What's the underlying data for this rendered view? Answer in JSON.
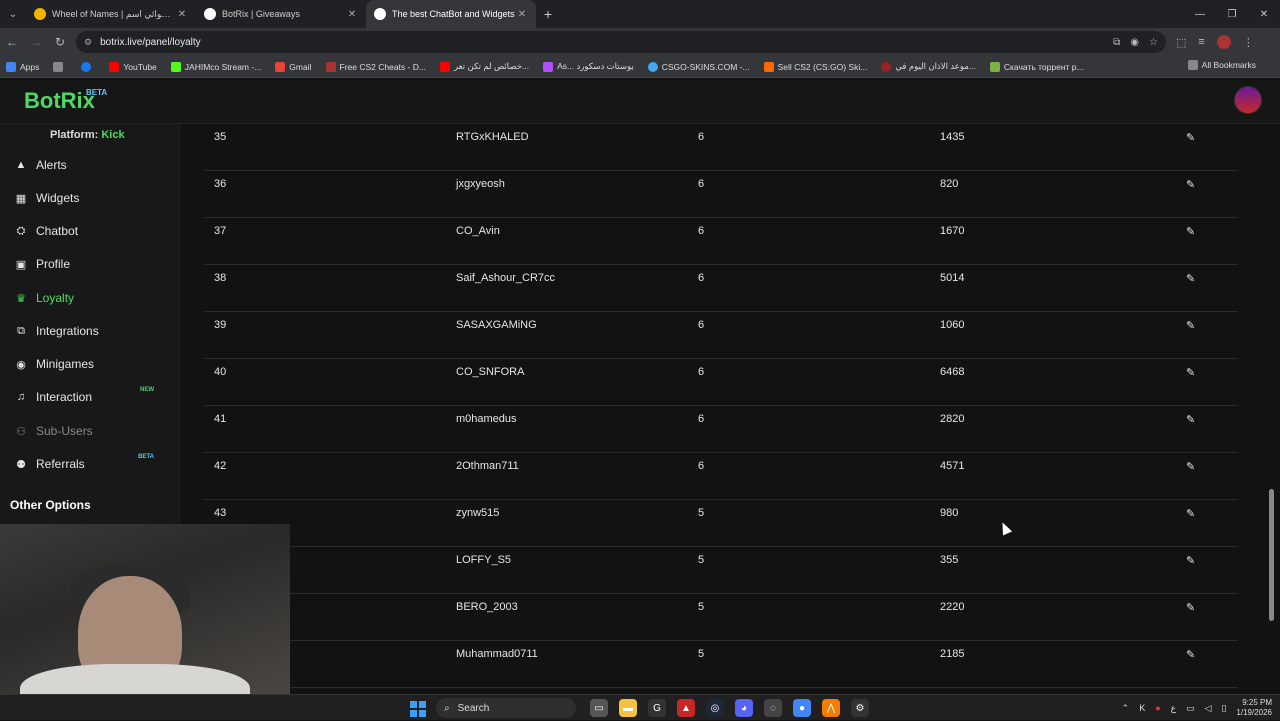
{
  "browser": {
    "tabs": [
      {
        "title": "Wheel of Names | العشوائي اسم",
        "icon": "wheel-icon",
        "color": "#f4b400"
      },
      {
        "title": "BotRix | Giveaways",
        "icon": "botrix-icon",
        "color": "#ffffff"
      },
      {
        "title": "The best ChatBot and Widgets",
        "icon": "botrix-icon",
        "color": "#ffffff"
      }
    ],
    "url": "botrix.live/panel/loyalty",
    "bookmarks": [
      {
        "label": "Apps",
        "color": "#4285f4"
      },
      {
        "label": "",
        "color": "#888888"
      },
      {
        "label": "",
        "color": "#1877f2"
      },
      {
        "label": "YouTube",
        "color": "#ff0000"
      },
      {
        "label": "JAHIMco Stream -...",
        "color": "#53fc18"
      },
      {
        "label": "Gmail",
        "color": "#ea4335"
      },
      {
        "label": "Free CS2 Cheats - D...",
        "color": "#aa3333"
      },
      {
        "label": "خصائص لم تكن تعر...",
        "color": "#ff0000"
      },
      {
        "label": "As... يوستات دسكورد",
        "color": "#b44cff"
      },
      {
        "label": "CSGO-SKINS.COM -...",
        "color": "#3fa9f5"
      },
      {
        "label": "Sell CS2 (CS:GO) Ski...",
        "color": "#ff6a00"
      },
      {
        "label": "موعد الاذان اليوم في...",
        "color": "#992222"
      },
      {
        "label": "Скачать торрент р...",
        "color": "#7cb342"
      }
    ],
    "all_bookmarks": "All Bookmarks"
  },
  "app": {
    "logo": "BotRix",
    "logo_badge": "BETA",
    "platform_label": "Platform:",
    "platform_value": "Kick"
  },
  "sidebar": {
    "items": [
      {
        "label": "Alerts",
        "icon": "alert-triangle-icon"
      },
      {
        "label": "Widgets",
        "icon": "grid-icon"
      },
      {
        "label": "Chatbot",
        "icon": "robot-icon"
      },
      {
        "label": "Profile",
        "icon": "id-card-icon"
      },
      {
        "label": "Loyalty",
        "icon": "trophy-icon",
        "active": true
      },
      {
        "label": "Integrations",
        "icon": "plug-icon"
      },
      {
        "label": "Minigames",
        "icon": "gamepad-icon"
      },
      {
        "label": "Interaction",
        "icon": "music-icon",
        "badge": "NEW",
        "badge_color": "#4cd964"
      },
      {
        "label": "Sub-Users",
        "icon": "users-icon",
        "disabled": true
      },
      {
        "label": "Referrals",
        "icon": "referral-icon",
        "badge": "BETA",
        "badge_color": "#5ac8fa"
      }
    ],
    "other_options": "Other Options"
  },
  "leaderboard": {
    "rows": [
      {
        "rank": "35",
        "name": "RTGxKHALED",
        "level": "6",
        "points": "1435"
      },
      {
        "rank": "36",
        "name": "jxgxyeosh",
        "level": "6",
        "points": "820"
      },
      {
        "rank": "37",
        "name": "CO_Avin",
        "level": "6",
        "points": "1670"
      },
      {
        "rank": "38",
        "name": "Saif_Ashour_CR7cc",
        "level": "6",
        "points": "5014"
      },
      {
        "rank": "39",
        "name": "SASAXGAMiNG",
        "level": "6",
        "points": "1060"
      },
      {
        "rank": "40",
        "name": "CO_SNFORA",
        "level": "6",
        "points": "6468"
      },
      {
        "rank": "41",
        "name": "m0hamedus",
        "level": "6",
        "points": "2820"
      },
      {
        "rank": "42",
        "name": "2Othman711",
        "level": "6",
        "points": "4571"
      },
      {
        "rank": "43",
        "name": "zynw515",
        "level": "5",
        "points": "980"
      },
      {
        "rank": "",
        "name": "LOFFY_S5",
        "level": "5",
        "points": "355"
      },
      {
        "rank": "",
        "name": "BERO_2003",
        "level": "5",
        "points": "2220"
      },
      {
        "rank": "",
        "name": "Muhammad0711",
        "level": "5",
        "points": "2185"
      }
    ]
  },
  "taskbar": {
    "search": "Search",
    "time": "9:25 PM",
    "date": "1/19/2026"
  }
}
